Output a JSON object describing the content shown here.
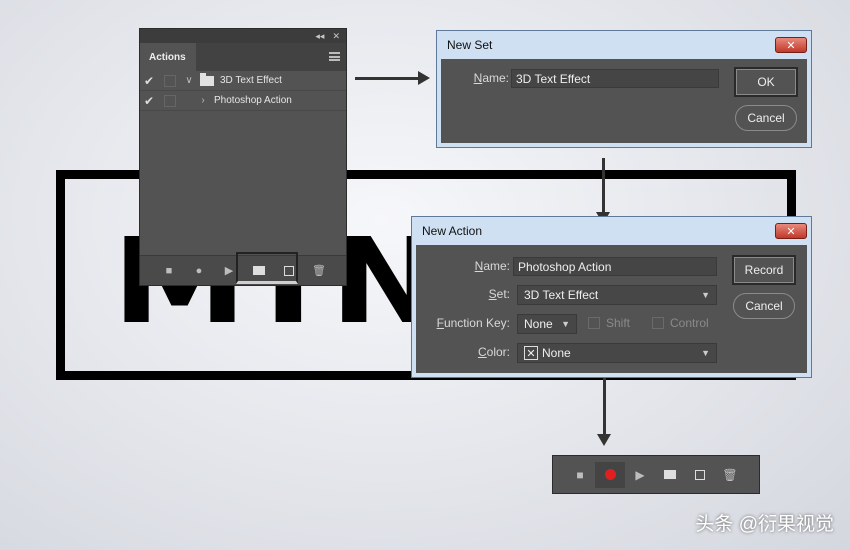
{
  "artwork": {
    "letters": "MINI"
  },
  "actions_panel": {
    "collapse_glyph": "◂◂",
    "close_glyph": "✕",
    "tab_label": "Actions",
    "rows": [
      {
        "check": "✔",
        "disclosure": "∨",
        "label": "3D Text Effect",
        "is_set": true
      },
      {
        "check": "✔",
        "disclosure": "›",
        "label": "Photoshop Action",
        "is_set": false
      }
    ],
    "bottom_icons": [
      "stop-icon",
      "record-icon",
      "play-icon",
      "new-set-icon",
      "new-action-icon",
      "delete-icon"
    ]
  },
  "new_set_dialog": {
    "title": "New Set",
    "close_glyph": "✕",
    "name_label_u": "N",
    "name_label_rest": "ame:",
    "name_value": "3D Text Effect",
    "ok_label": "OK",
    "cancel_label": "Cancel"
  },
  "new_action_dialog": {
    "title": "New Action",
    "close_glyph": "✕",
    "name_label_u": "N",
    "name_label_rest": "ame:",
    "name_value": "Photoshop Action",
    "set_label_u": "S",
    "set_label_rest": "et:",
    "set_value": "3D Text Effect",
    "function_key_label_u": "F",
    "function_key_label_rest": "unction Key:",
    "function_key_value": "None",
    "shift_label": "Shift",
    "control_label": "Control",
    "color_label_u": "C",
    "color_label_rest": "olor:",
    "color_value": "None",
    "record_label": "Record",
    "cancel_label": "Cancel"
  },
  "watermark": "头条 @衍果视觉",
  "colors": {
    "panel_bg": "#535353",
    "dialog_frame": "#cfe0f2",
    "record_red": "#e02020",
    "close_red": "#c0392b"
  }
}
